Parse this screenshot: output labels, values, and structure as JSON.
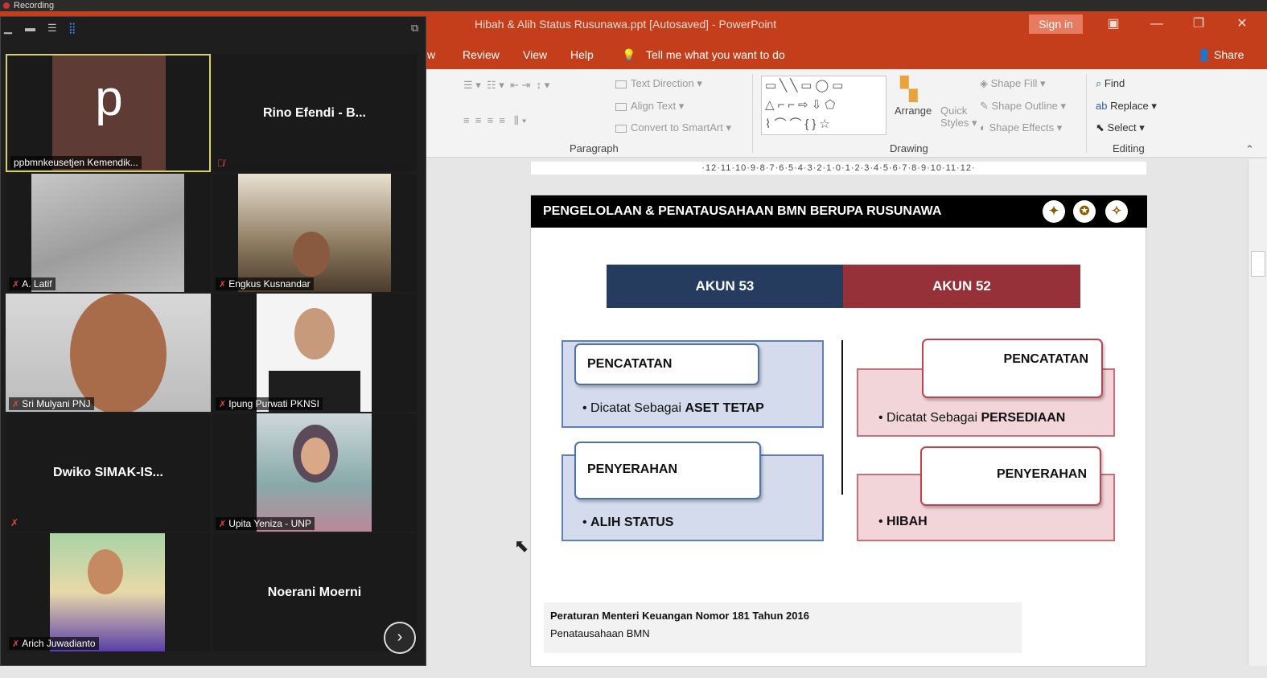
{
  "recording": {
    "label": "Recording"
  },
  "ppt": {
    "title": "Hibah & Alih Status Rusunawa.ppt [Autosaved]  -  PowerPoint",
    "signin": "Sign in",
    "share": "Share",
    "menu": {
      "partial_tab": "w",
      "review": "Review",
      "view": "View",
      "help": "Help",
      "tell_me": "Tell me what you want to do"
    },
    "ribbon": {
      "text_direction": "Text Direction",
      "align_text": "Align Text",
      "convert_smartart": "Convert to SmartArt",
      "paragraph": "Paragraph",
      "arrange": "Arrange",
      "quick_styles_1": "Quick",
      "quick_styles_2": "Styles",
      "shape_fill": "Shape Fill",
      "shape_outline": "Shape Outline",
      "shape_effects": "Shape Effects",
      "drawing": "Drawing",
      "find": "Find",
      "replace": "Replace",
      "select": "Select",
      "editing": "Editing"
    },
    "ruler": "·12·11·10·9·8·7·6·5·4·3·2·1·0·1·2·3·4·5·6·7·8·9·10·11·12·"
  },
  "slide": {
    "header": "PENGELOLAAN & PENATAUSAHAAN BMN BERUPA RUSUNAWA",
    "akun53": "AKUN 53",
    "akun52": "AKUN 52",
    "left_box1_title": "PENCATATAN",
    "left_box1_bullet_plain": "Dicatat Sebagai ",
    "left_box1_bullet_bold": "ASET TETAP",
    "left_box2_title": "PENYERAHAN",
    "left_box2_bullet": "ALIH STATUS",
    "right_box1_title": "PENCATATAN",
    "right_box1_bullet_plain": "Dicatat Sebagai ",
    "right_box1_bullet_bold": "PERSEDIAAN",
    "right_box2_title": "PENYERAHAN",
    "right_box2_bullet": "HIBAH",
    "footnote_line1": "Peraturan Menteri Keuangan Nomor 181 Tahun 2016",
    "footnote_line2": "Penatausahaan BMN"
  },
  "zoom": {
    "participants": {
      "p1": "ppbmnkeusetjen Kemendik...",
      "p1_initial": "p",
      "p2": "Rino Efendi  - B...",
      "p3": "A. Latif",
      "p4": "Engkus Kusnandar",
      "p5": "Sri Mulyani PNJ",
      "p6": "Ipung Purwati PKNSI",
      "p7": "Dwiko  SIMAK-IS...",
      "p8": "Upita Yeniza - UNP",
      "p9": "Arich Juwadianto",
      "p10": "Noerani Moerni"
    }
  }
}
